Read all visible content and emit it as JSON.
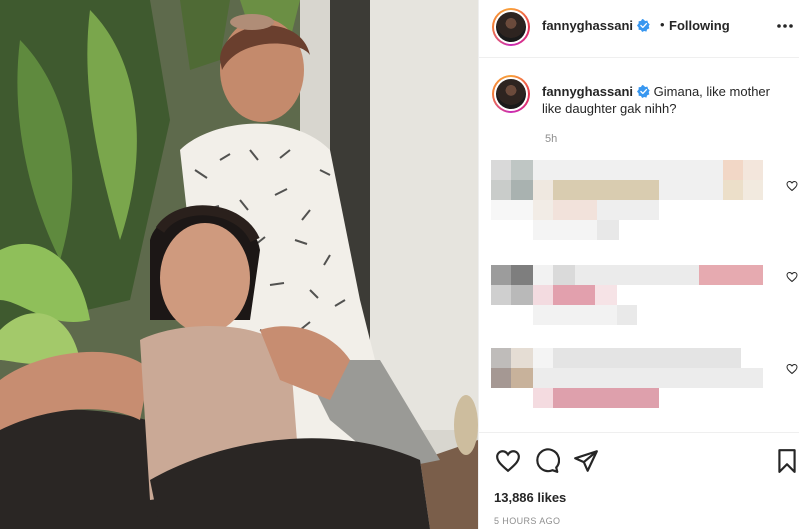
{
  "post": {
    "photo_alt": "photo",
    "header": {
      "username": "fannyghassani",
      "separator": "•",
      "follow_status": "Following",
      "more_icon": "more-horizontal-icon",
      "verified_icon": "verified-badge-icon"
    },
    "caption": {
      "username": "fannyghassani",
      "text": "Gimana, like mother like daughter gak nihh?",
      "time": "5h"
    },
    "actions": {
      "like_icon": "heart-icon",
      "comment_icon": "comment-icon",
      "share_icon": "share-icon",
      "save_icon": "bookmark-icon"
    },
    "likes": "13,886 likes",
    "posted_ago": "5 HOURS AGO"
  },
  "colors": {
    "accent_link": "#0095f6",
    "verified": "#3897f0",
    "muted": "#8e8e8e",
    "text": "#262626"
  }
}
